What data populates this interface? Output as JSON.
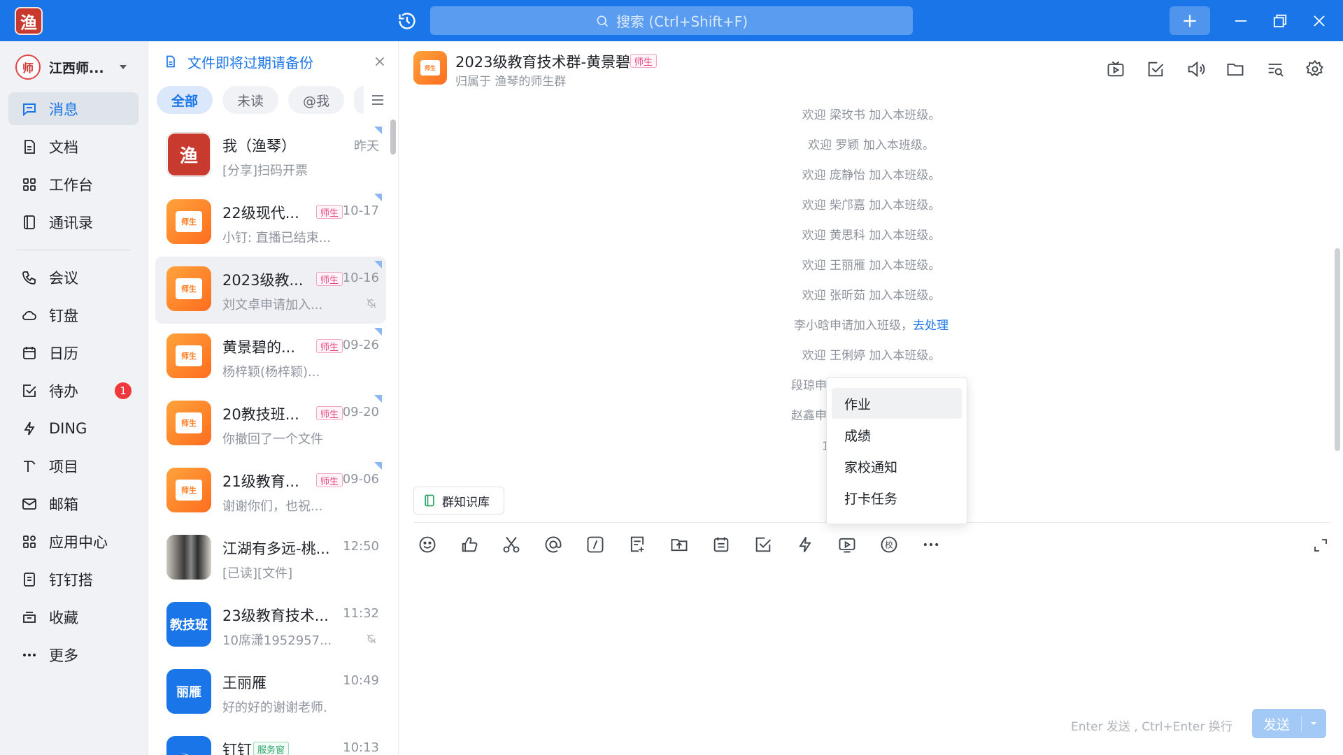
{
  "topbar": {
    "logo_text": "渔",
    "search_placeholder": "搜索 (Ctrl+Shift+F)"
  },
  "nav": {
    "org_name": "江西师...",
    "org_avatar_text": "师",
    "items": [
      {
        "label": "消息",
        "icon": "message-icon",
        "active": true
      },
      {
        "label": "文档",
        "icon": "document-icon"
      },
      {
        "label": "工作台",
        "icon": "grid-icon"
      },
      {
        "label": "通讯录",
        "icon": "contacts-icon"
      },
      {
        "label": "会议",
        "icon": "phone-icon"
      },
      {
        "label": "钉盘",
        "icon": "cloud-icon"
      },
      {
        "label": "日历",
        "icon": "calendar-icon"
      },
      {
        "label": "待办",
        "icon": "todo-icon",
        "badge": "1"
      },
      {
        "label": "DING",
        "icon": "lightning-icon"
      },
      {
        "label": "项目",
        "icon": "project-icon"
      },
      {
        "label": "邮箱",
        "icon": "mail-icon"
      },
      {
        "label": "应用中心",
        "icon": "apps-icon"
      },
      {
        "label": "钉钉搭",
        "icon": "builder-icon"
      },
      {
        "label": "收藏",
        "icon": "favorite-icon"
      },
      {
        "label": "更多",
        "icon": "more-icon"
      }
    ]
  },
  "conv_panel": {
    "notice": "文件即将过期请备份",
    "filters": [
      "全部",
      "未读",
      "@我"
    ],
    "items": [
      {
        "title": "我（渔琴）",
        "time": "昨天",
        "sub": "[分享]扫码开票",
        "avatar": "seal",
        "avatar_text": "渔"
      },
      {
        "title": "22级现代...",
        "tag": "师生",
        "time": "10-17",
        "sub": "小钉: 直播已结束...",
        "avatar": "orange",
        "avatar_text": "师生"
      },
      {
        "title": "2023级教...",
        "tag": "师生",
        "time": "10-16",
        "sub": "刘文卓申请加入...",
        "avatar": "orange",
        "avatar_text": "师生",
        "active": true,
        "muted": true
      },
      {
        "title": "黄景碧的...",
        "tag": "师生",
        "time": "09-26",
        "sub": "杨梓颖(杨梓颖)...",
        "avatar": "orange",
        "avatar_text": "师生"
      },
      {
        "title": "20教技班...",
        "tag": "师生",
        "time": "09-20",
        "sub": "你撤回了一个文件",
        "avatar": "orange",
        "avatar_text": "师生"
      },
      {
        "title": "21级教育...",
        "tag": "师生",
        "time": "09-06",
        "sub": "谢谢你们，也祝...",
        "avatar": "orange",
        "avatar_text": "师生"
      },
      {
        "title": "江湖有多远-桃...",
        "time": "12:50",
        "sub": "[已读][文件]",
        "avatar": "photo"
      },
      {
        "title": "23级教育技术...",
        "time": "11:32",
        "sub": "10席潇1952957...",
        "avatar": "blue",
        "avatar_text": "教技班",
        "muted": true
      },
      {
        "title": "王丽雁",
        "time": "10:49",
        "sub": "好的好的谢谢老师.",
        "avatar": "blue",
        "avatar_text": "丽雁"
      },
      {
        "title": "钉钉",
        "tag": "服务窗",
        "tag_color": "green",
        "time": "10:13",
        "sub": "",
        "avatar": "blue"
      }
    ]
  },
  "chat": {
    "title": "2023级教育技术群-黄景碧",
    "tag": "师生",
    "subtitle": "归属于 渔琴的师生群",
    "avatar_text": "师生",
    "messages": [
      {
        "text": "欢迎 梁玫书 加入本班级。"
      },
      {
        "text": "欢迎 罗颖 加入本班级。"
      },
      {
        "text": "欢迎 庞静怡 加入本班级。"
      },
      {
        "text": "欢迎 柴邝嘉 加入本班级。"
      },
      {
        "text": "欢迎 黄思科 加入本班级。"
      },
      {
        "text": "欢迎 王丽雁 加入本班级。"
      },
      {
        "text": "欢迎 张昕茹 加入本班级。"
      },
      {
        "text": "李小晗申请加入班级，",
        "link": "去处理"
      },
      {
        "text": "欢迎 王俐婷 加入本班级。"
      },
      {
        "text": "段琼申"
      },
      {
        "text": "赵鑫申"
      },
      {
        "text": "1"
      }
    ],
    "knowledge_btn": "群知识库",
    "input_hint": "Enter 发送 , Ctrl+Enter 换行",
    "send_label": "发送"
  },
  "popup": {
    "items": [
      "作业",
      "成绩",
      "家校通知",
      "打卡任务"
    ]
  }
}
